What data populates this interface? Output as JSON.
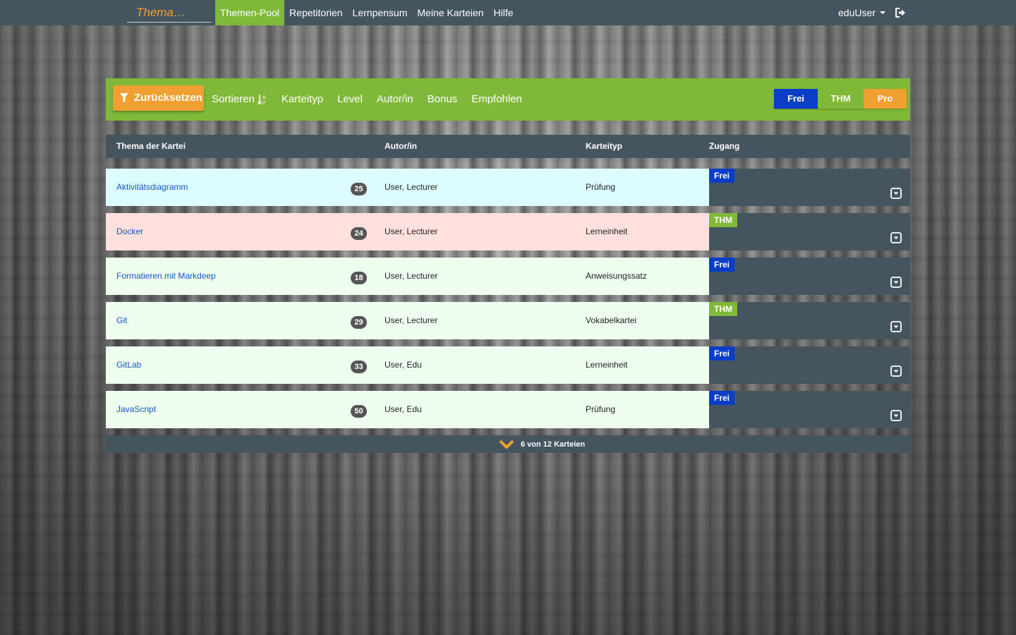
{
  "navbar": {
    "brand": "Thema…",
    "links": [
      "Themen-Pool",
      "Repetitorien",
      "Lernpensum",
      "Meine Karteien",
      "Hilfe"
    ],
    "active_link": "Themen-Pool",
    "user": "eduUser",
    "logout_icon": "logout-icon"
  },
  "filterbar": {
    "reset_label": "Zurücksetzen",
    "filter_icon": "filter-icon",
    "items": [
      "Sortieren",
      "Karteityp",
      "Level",
      "Autor/in",
      "Bonus",
      "Empfohlen"
    ],
    "sort_icon": "sort-alpha-icon",
    "access": [
      "Frei",
      "THM",
      "Pro"
    ]
  },
  "table": {
    "headers": [
      "Thema der Kartei",
      "Autor/in",
      "Karteityp",
      "Zugang"
    ],
    "rows": [
      {
        "title": "Aktivitätsdiagramm",
        "count": "25",
        "author": "User, Lecturer",
        "type": "Prüfung",
        "access": "Frei",
        "bg": "#ddfcff"
      },
      {
        "title": "Docker",
        "count": "24",
        "author": "User, Lecturer",
        "type": "Lerneinheit",
        "access": "THM",
        "bg": "#ffe0dc"
      },
      {
        "title": "Formatieren mit Markdeep",
        "count": "18",
        "author": "User, Lecturer",
        "type": "Anweisungssatz",
        "access": "Frei",
        "bg": "#eefff0"
      },
      {
        "title": "Git",
        "count": "29",
        "author": "User, Lecturer",
        "type": "Vokabelkartei",
        "access": "THM",
        "bg": "#eefff0"
      },
      {
        "title": "GitLab",
        "count": "33",
        "author": "User, Edu",
        "type": "Lerneinheit",
        "access": "Frei",
        "bg": "#eefff0"
      },
      {
        "title": "JavaScript",
        "count": "50",
        "author": "User, Edu",
        "type": "Prüfung",
        "access": "Frei",
        "bg": "#eefff0"
      }
    ]
  },
  "footer": {
    "more_label": "6 von 12 Karteien",
    "chevron_icon": "chevron-down-icon"
  },
  "colors": {
    "navbar": "#455560",
    "green": "#80b93a",
    "orange": "#f0a030",
    "blue": "#0b3ec8"
  }
}
